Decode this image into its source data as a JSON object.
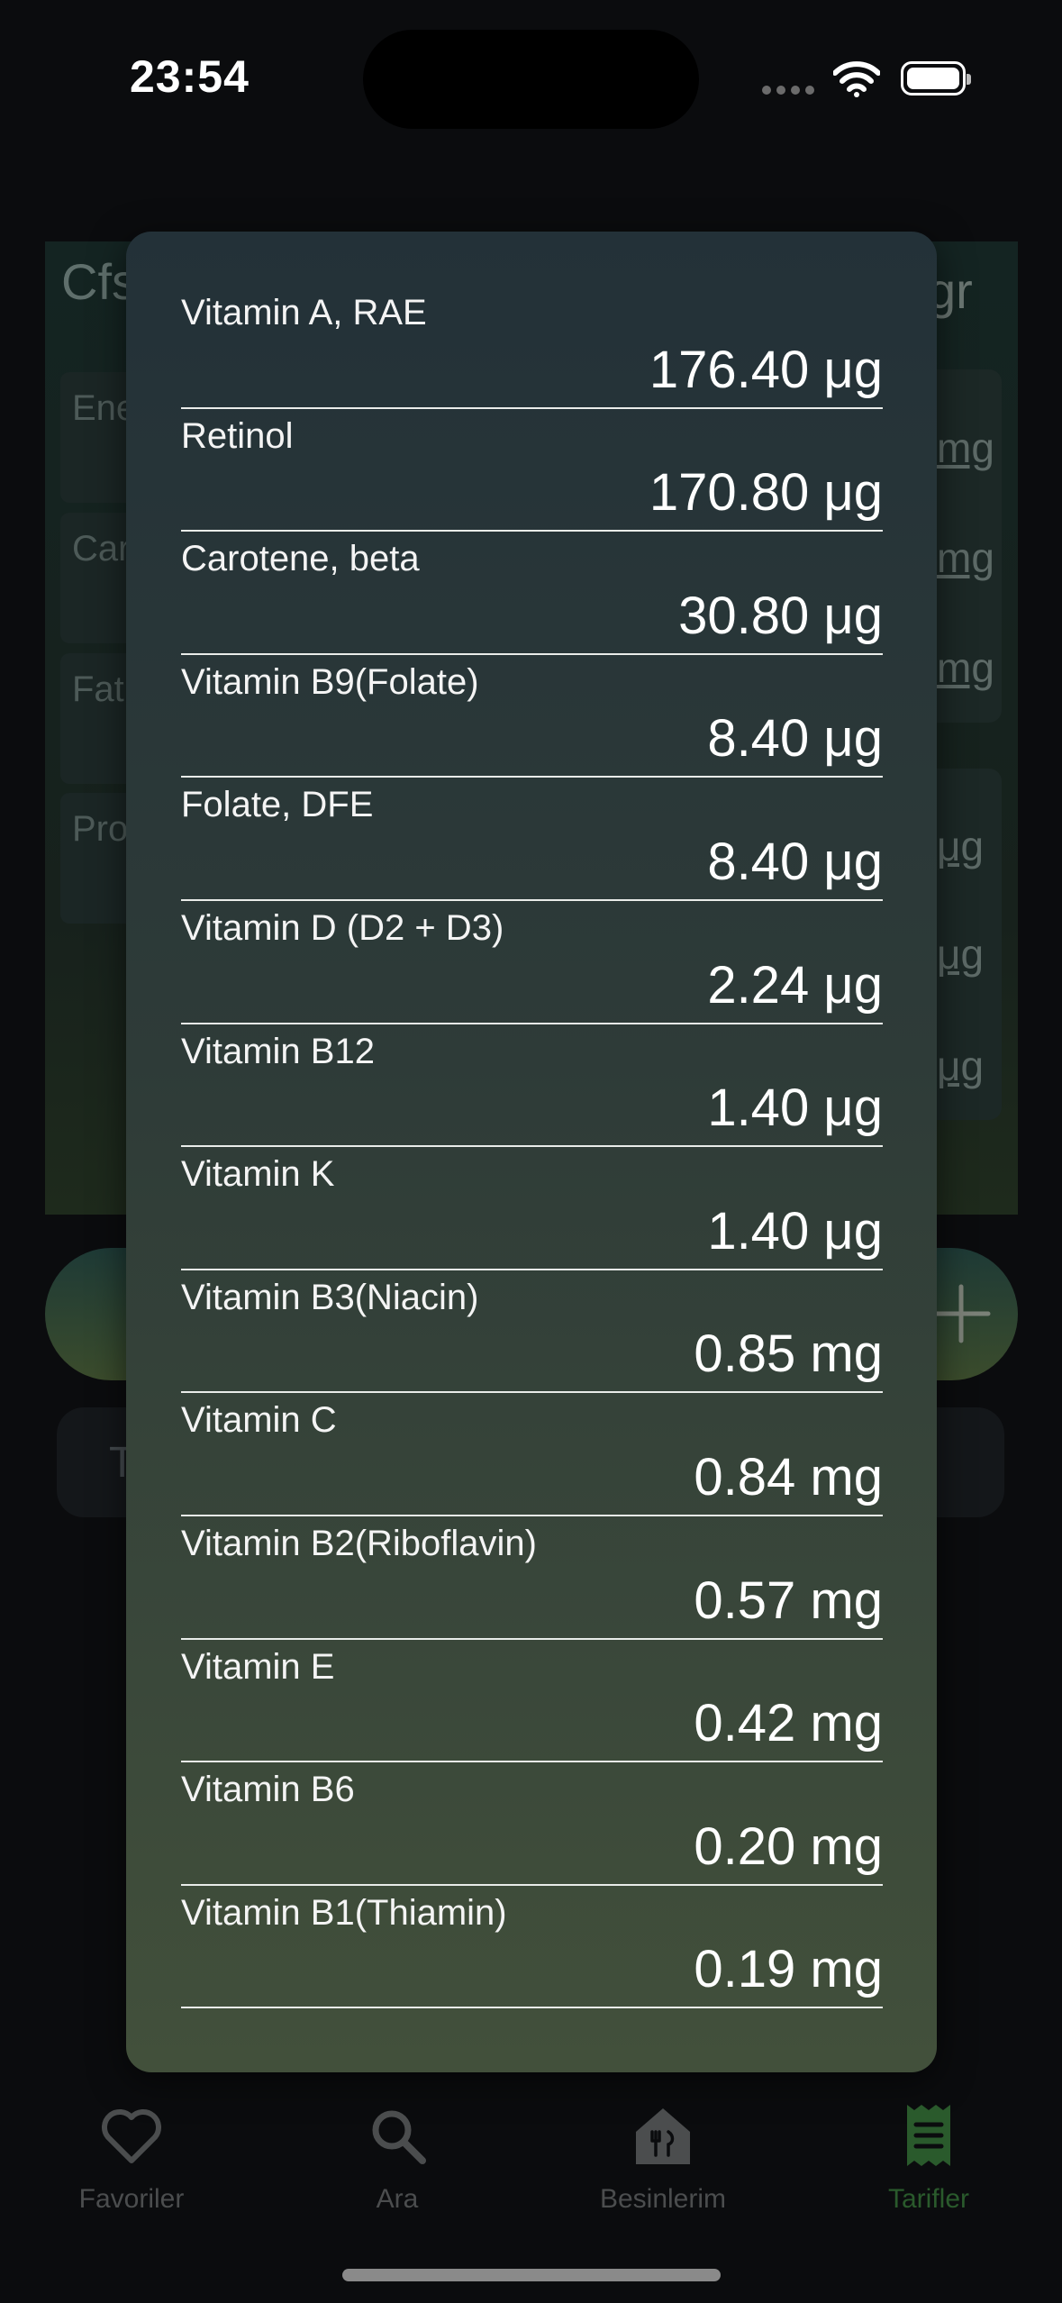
{
  "status_bar": {
    "time": "23:54"
  },
  "background": {
    "title_fragment": "Cfs",
    "unit_fragment": "gr",
    "cards": [
      "Ene",
      "Car",
      "Fat",
      "Pro"
    ],
    "right_values": [
      "mg",
      "mg",
      "mg",
      "μg",
      "μg",
      "μg"
    ],
    "search_fragment": "T"
  },
  "modal": {
    "rows": [
      {
        "name": "Vitamin A, RAE",
        "amount": "176.40 μg"
      },
      {
        "name": "Retinol",
        "amount": "170.80 μg"
      },
      {
        "name": "Carotene, beta",
        "amount": "30.80 μg"
      },
      {
        "name": "Vitamin B9(Folate)",
        "amount": "8.40 μg"
      },
      {
        "name": "Folate, DFE",
        "amount": "8.40 μg"
      },
      {
        "name": "Vitamin D (D2 + D3)",
        "amount": "2.24 μg"
      },
      {
        "name": "Vitamin B12",
        "amount": "1.40 μg"
      },
      {
        "name": "Vitamin K",
        "amount": "1.40 μg"
      },
      {
        "name": "Vitamin B3(Niacin)",
        "amount": "0.85 mg"
      },
      {
        "name": "Vitamin C",
        "amount": "0.84 mg"
      },
      {
        "name": "Vitamin B2(Riboflavin)",
        "amount": "0.57 mg"
      },
      {
        "name": "Vitamin E",
        "amount": "0.42 mg"
      },
      {
        "name": "Vitamin B6",
        "amount": "0.20 mg"
      },
      {
        "name": "Vitamin B1(Thiamin)",
        "amount": "0.19 mg"
      }
    ]
  },
  "tab_bar": {
    "tabs": [
      {
        "label": "Favoriler",
        "icon": "heart-icon"
      },
      {
        "label": "Ara",
        "icon": "search-icon"
      },
      {
        "label": "Besinlerim",
        "icon": "food-house-icon"
      },
      {
        "label": "Tarifler",
        "icon": "receipt-icon",
        "active": true
      }
    ]
  },
  "colors": {
    "active_tab": "#2a5a2c",
    "inactive_tab": "#4b4d4e"
  }
}
